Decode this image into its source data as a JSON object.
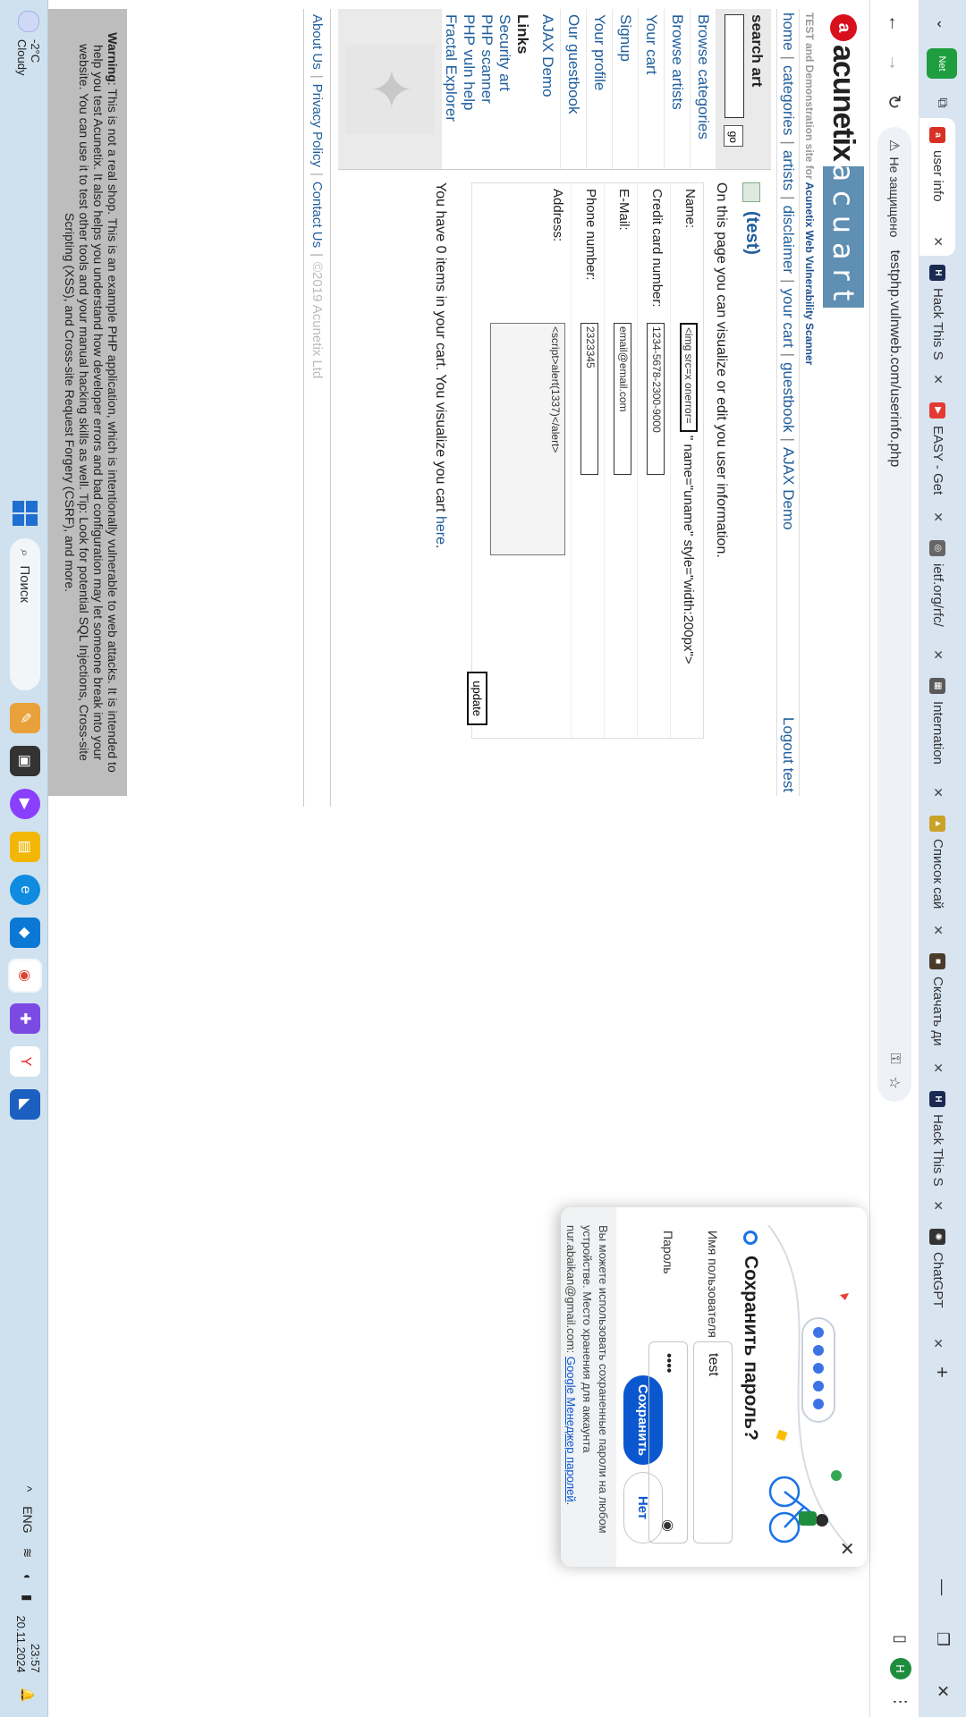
{
  "browser": {
    "tabs": [
      {
        "label": "user info",
        "fav_color": "#d93025",
        "fav_glyph": "a",
        "active": true
      },
      {
        "label": "Hack This S",
        "fav_color": "#1b2a52",
        "fav_glyph": "H",
        "active": false
      },
      {
        "label": "EASY - Get",
        "fav_color": "#e53935",
        "fav_glyph": "▶",
        "active": false
      },
      {
        "label": "ietf.org/rfc/",
        "fav_color": "#666666",
        "fav_glyph": "◎",
        "active": false
      },
      {
        "label": "Internation",
        "fav_color": "#5a5a5a",
        "fav_glyph": "▦",
        "active": false
      },
      {
        "label": "Список сай",
        "fav_color": "#c9a227",
        "fav_glyph": "▲",
        "active": false
      },
      {
        "label": "Скачать ди",
        "fav_color": "#4a3b2a",
        "fav_glyph": "■",
        "active": false
      },
      {
        "label": "Hack This S",
        "fav_color": "#1b2a52",
        "fav_glyph": "H",
        "active": false
      },
      {
        "label": "ChatGPT",
        "fav_color": "#333333",
        "fav_glyph": "✺",
        "active": false
      }
    ],
    "security_label": "Не защищено",
    "url": "testphp.vulnweb.com/userinfo.php",
    "profile_initial": "Н"
  },
  "site": {
    "tagline_prefix": "TEST and Demonstration site for ",
    "tagline_brand": "Acunetix Web Vulnerability Scanner",
    "logo_word": "acunetix",
    "logo_art": "acuart",
    "topnav": [
      "home",
      "categories",
      "artists",
      "disclaimer",
      "your cart",
      "guestbook",
      "AJAX Demo"
    ],
    "logout": "Logout test",
    "search_title": "search art",
    "go_label": "go",
    "sidebar_links": [
      "Browse categories",
      "Browse artists",
      "Your cart",
      "Signup",
      "Your profile",
      "Our guestbook",
      "AJAX Demo"
    ],
    "links_title": "Links",
    "external_links": [
      "Security art",
      "PHP scanner",
      "PHP vuln help",
      "Fractal Explorer"
    ],
    "page_title": "(test)",
    "intro": "On this page you can visualize or edit you user information.",
    "form": {
      "name_label": "Name:",
      "name_value": "<img src=x onerror=",
      "name_tail": "\" name=\"uname\" style=\"width:200px\">",
      "cc_label": "Credit card number:",
      "cc_value": "1234-5678-2300-9000",
      "email_label": "E-Mail:",
      "email_value": "email@email.com",
      "phone_label": "Phone number:",
      "phone_value": "2323345",
      "address_label": "Address:",
      "address_value": "<script>alert(1337)</alert>",
      "update_label": "update"
    },
    "cart_text": "You have 0 items in your cart. You visualize you cart ",
    "cart_link": "here",
    "cart_end": ".",
    "footer": [
      "About Us",
      "Privacy Policy",
      "Contact Us"
    ],
    "copyright": "©2019 Acunetix Ltd",
    "warning_bold": "Warning",
    "warning_text": ": This is not a real shop. This is an example PHP application, which is intentionally vulnerable to web attacks. It is intended to help you test Acunetix. It also helps you understand how developer errors and bad configuration may let someone break into your website. You can use it to test other tools and your manual hacking skills as well. Tip: Look for potential SQL Injections, Cross-site Scripting (XSS), and Cross-site Request Forgery (CSRF), and more."
  },
  "password_popup": {
    "title": "Сохранить пароль?",
    "username_label": "Имя пользователя",
    "username_value": "test",
    "password_label": "Пароль",
    "password_value": "••••",
    "save_label": "Сохранить",
    "no_label": "Нет",
    "footnote": "Вы можете использовать сохраненные пароли на любом устройстве. Место хранения для аккаунта nur.abaikan@gmail.com: ",
    "footnote_link": "Google Менеджер паролей",
    "footnote_end": "."
  },
  "taskbar": {
    "temperature": "-2°C",
    "weather": "Cloudy",
    "search_placeholder": "Поиск",
    "language": "ENG",
    "time": "23:57",
    "date": "20.11.2024"
  }
}
